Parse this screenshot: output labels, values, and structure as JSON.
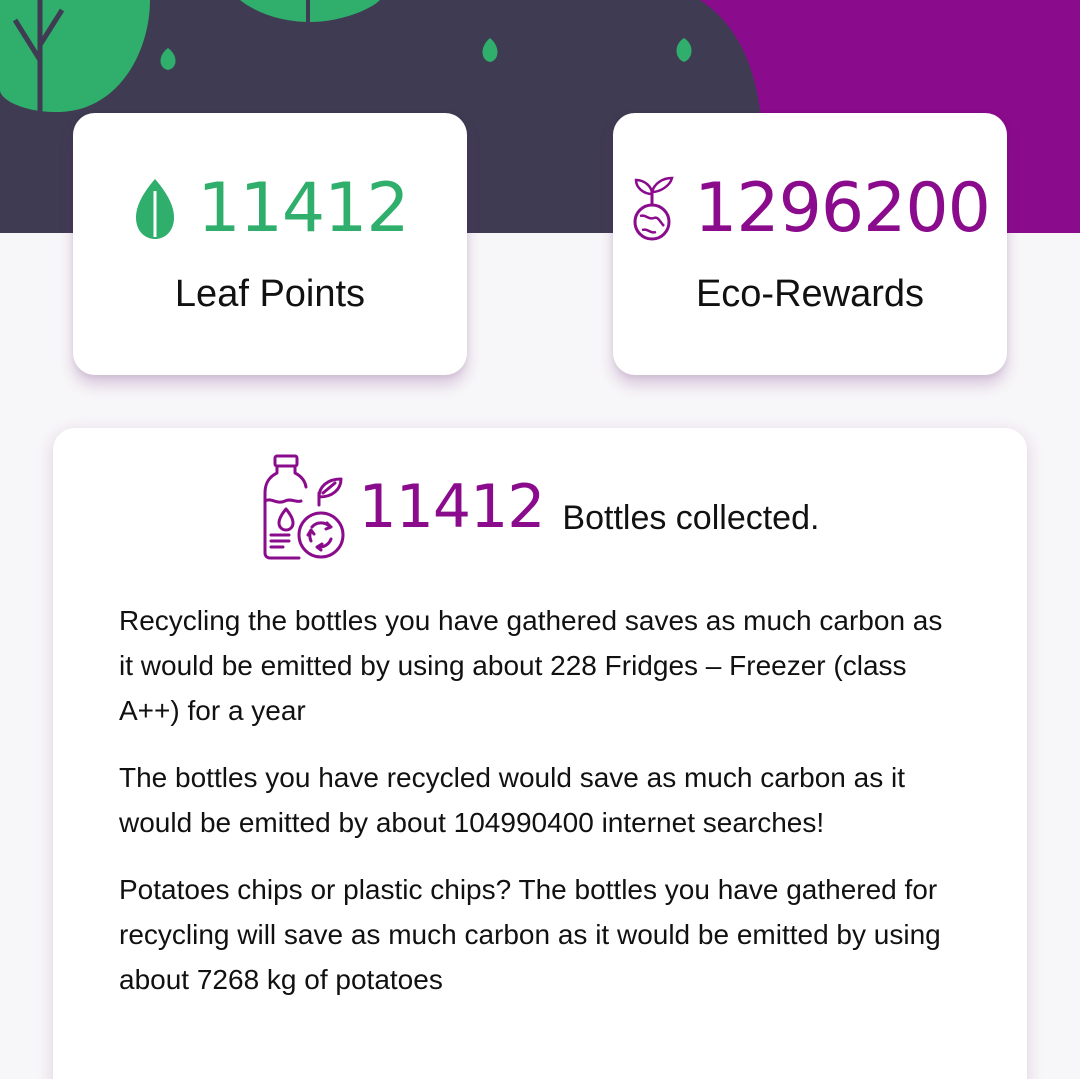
{
  "colors": {
    "green": "#2fae6c",
    "purple": "#8a0b8c",
    "dark_header": "#3f3b52"
  },
  "stats": {
    "leaf": {
      "icon": "leaf-icon",
      "value": "11412",
      "label": "Leaf Points"
    },
    "eco": {
      "icon": "eco-globe-plant-icon",
      "value": "1296200",
      "label": "Eco-Rewards"
    }
  },
  "bottles": {
    "icon": "bottle-recycle-icon",
    "value": "11412",
    "label": "Bottles collected."
  },
  "facts": [
    "Recycling the bottles you have gathered saves as much carbon as it would be emitted by using about 228 Fridges – Freezer (class A++) for a year",
    "The bottles you have recycled would save as much carbon as it would be emitted by about 104990400 internet searches!",
    "Potatoes chips or plastic chips? The bottles you have gathered for recycling will save as much carbon as it would be emitted by using about 7268 kg of potatoes"
  ]
}
